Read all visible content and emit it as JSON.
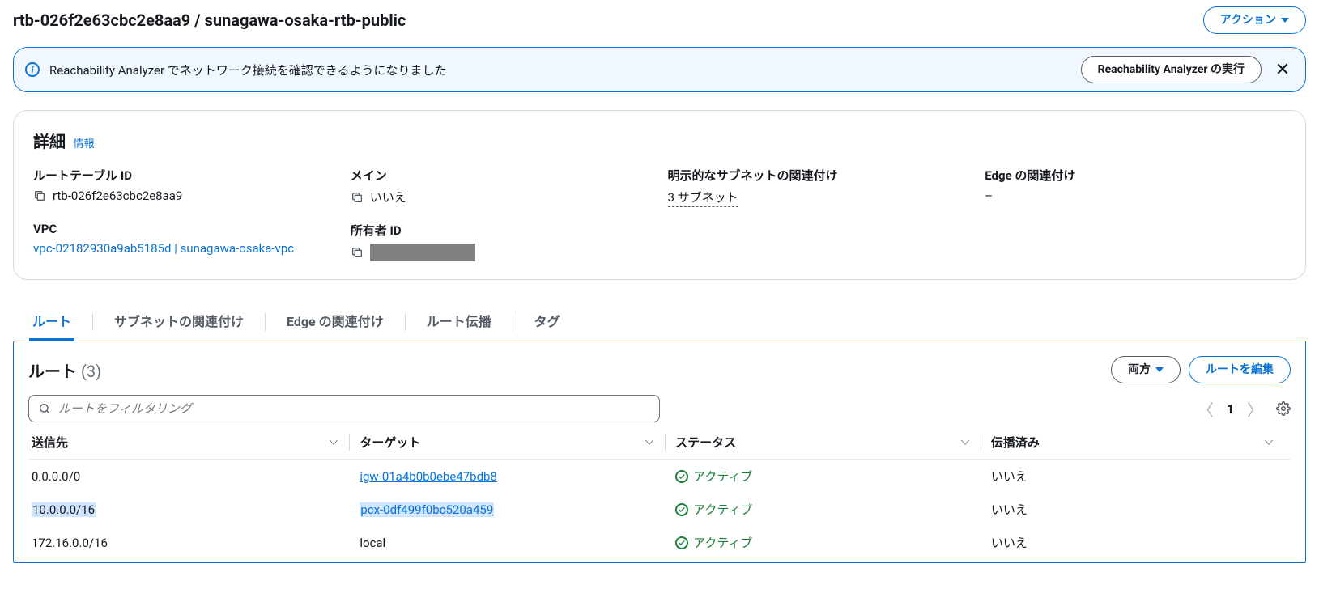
{
  "header": {
    "title": "rtb-026f2e63cbc2e8aa9 / sunagawa-osaka-rtb-public",
    "action_button": "アクション"
  },
  "banner": {
    "text": "Reachability Analyzer でネットワーク接続を確認できるようになりました",
    "run_button": "Reachability Analyzer の実行"
  },
  "details": {
    "title": "詳細",
    "info_link": "情報",
    "fields": {
      "rtb_id_label": "ルートテーブル ID",
      "rtb_id_value": "rtb-026f2e63cbc2e8aa9",
      "main_label": "メイン",
      "main_value": "いいえ",
      "subnet_assoc_label": "明示的なサブネットの関連付け",
      "subnet_assoc_value": "3 サブネット",
      "edge_assoc_label": "Edge の関連付け",
      "edge_assoc_value": "–",
      "vpc_label": "VPC",
      "vpc_value": "vpc-02182930a9ab5185d | sunagawa-osaka-vpc",
      "owner_label": "所有者 ID"
    }
  },
  "tabs": {
    "items": [
      "ルート",
      "サブネットの関連付け",
      "Edge の関連付け",
      "ルート伝播",
      "タグ"
    ],
    "active_index": 0
  },
  "routes_panel": {
    "title": "ルート",
    "count": "(3)",
    "both_button": "両方",
    "edit_button": "ルートを編集",
    "filter_placeholder": "ルートをフィルタリング",
    "page": "1",
    "columns": {
      "destination": "送信先",
      "target": "ターゲット",
      "status": "ステータス",
      "propagated": "伝播済み"
    },
    "status_active": "アクティブ",
    "rows": [
      {
        "destination": "0.0.0.0/0",
        "target": "igw-01a4b0b0ebe47bdb8",
        "target_link": true,
        "highlighted": false,
        "propagated": "いいえ"
      },
      {
        "destination": "10.0.0.0/16",
        "target": "pcx-0df499f0bc520a459",
        "target_link": true,
        "highlighted": true,
        "propagated": "いいえ"
      },
      {
        "destination": "172.16.0.0/16",
        "target": "local",
        "target_link": false,
        "highlighted": false,
        "propagated": "いいえ"
      }
    ]
  }
}
